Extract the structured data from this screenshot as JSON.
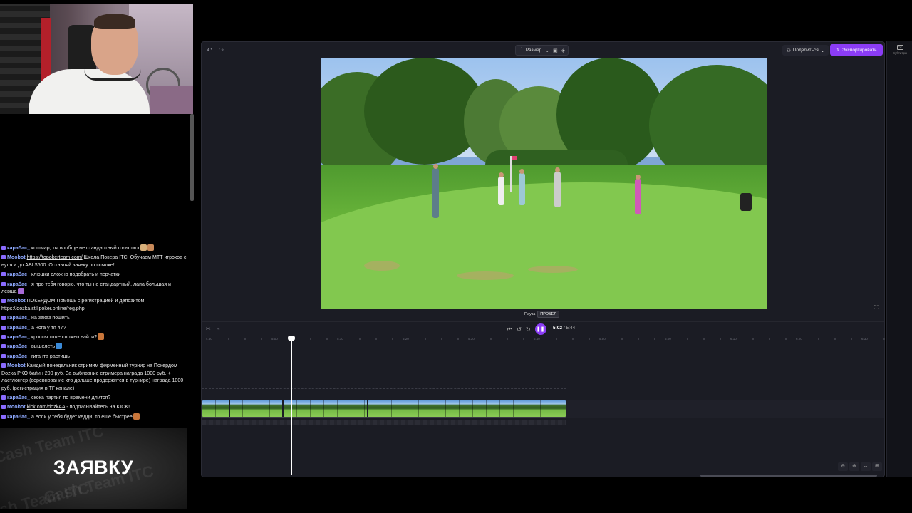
{
  "chat": {
    "messages": [
      {
        "user": "карабас_",
        "text": "кошмар, ты вообще не стандартный гольфист",
        "emotes": [
          "#d8b07a",
          "#c98a5a"
        ]
      },
      {
        "user": "Moobot",
        "link": "https://topokerteam.com/",
        "text": " Школа Покера ITC. Обучаем МТТ игроков с нуля и до ABI $600. Оставляй заявку по ссылке!",
        "emotes": []
      },
      {
        "user": "карабас_",
        "text": "клюшки сложно подобрать и перчатки",
        "emotes": []
      },
      {
        "user": "карабас_",
        "text": "я про тебя говорю, что ты не стандартный, лапа большая и левша",
        "emotes": [
          "#a86ad8"
        ]
      },
      {
        "user": "Moobot",
        "text": "ПОКЕРДОМ Помощь с регистрацией и депозитом. ",
        "link": "https://dozka.stillpoker.online/reg.php",
        "emotes": []
      },
      {
        "user": "карабас_",
        "text": "на заказ пошить",
        "emotes": []
      },
      {
        "user": "карабас_",
        "text": "а нога у тя 47?",
        "emotes": []
      },
      {
        "user": "карабас_",
        "text": "кроссы тоже сложно найти?",
        "emotes": [
          "#c9763a"
        ]
      },
      {
        "user": "карабас_",
        "text": "вышелеть",
        "emotes": [
          "#3a8ad8"
        ]
      },
      {
        "user": "карабас_",
        "text": "гиганта растишь",
        "emotes": []
      },
      {
        "user": "Moobot",
        "text": "Каждый понедельник стримим фирменный турнир на Покердом Dozka PKO байин 200 руб. За выбивание стримера награда 1000 руб. + ластлонгер (соревнование кто дольше продержится в турнире) награда 1000 руб. (регистрация в ТГ канале)",
        "emotes": []
      },
      {
        "user": "карабас_",
        "text": "скока партия по времени длится?",
        "emotes": []
      },
      {
        "user": "Moobot",
        "link": "kick.com/dozkAA",
        "text": " - подписывайтесь на KICK!",
        "emotes": []
      },
      {
        "user": "карабас_",
        "text": "а если у тебя будет кедди, то ещё быстрее",
        "emotes": [
          "#c9763a"
        ]
      }
    ],
    "user_colors": {
      "карабас_": "#8ea9ff",
      "Moobot": "#8ea9ff"
    }
  },
  "promo": {
    "text": "ЗАЯВКУ",
    "watermark": "Cash Team ITC"
  },
  "editor": {
    "toolbar": {
      "size_label": "Размер",
      "share_label": "Поделиться",
      "export_label": "Экспортировать"
    },
    "side_rail": {
      "captions_label": "Субтитры"
    },
    "tooltip": {
      "label": "Пауза",
      "key": "ПРОБЕЛ"
    },
    "playback": {
      "current": "5:02",
      "separator": " / ",
      "total": "5:44"
    },
    "ruler_ticks": [
      "4:50",
      "5:00",
      "5:10",
      "5:20",
      "5:30",
      "5:40",
      "5:50",
      "6:00",
      "6:10",
      "6:20",
      "6:30"
    ]
  },
  "colors": {
    "accent": "#8b3cf6",
    "editor_bg": "#1b1c24",
    "chat_user": "#8ea9ff"
  }
}
